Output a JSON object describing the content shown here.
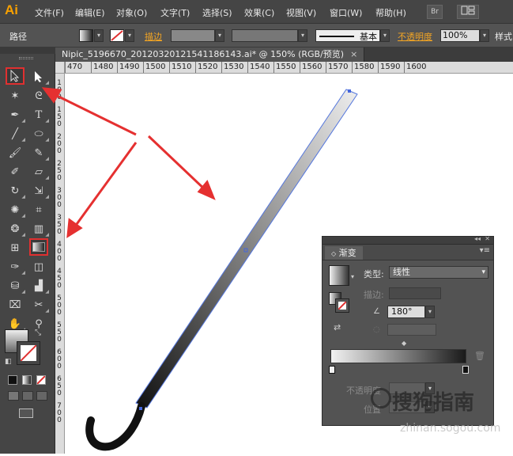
{
  "app": {
    "logo": "Ai"
  },
  "menu": [
    "文件(F)",
    "编辑(E)",
    "对象(O)",
    "文字(T)",
    "选择(S)",
    "效果(C)",
    "视图(V)",
    "窗口(W)",
    "帮助(H)"
  ],
  "menubar_buttons": {
    "bridge": "Br"
  },
  "control_bar": {
    "selection_label": "路径",
    "stroke_label": "描边",
    "stroke_style": "基本",
    "opacity_label": "不透明度",
    "opacity_value": "100%",
    "style_label": "样式"
  },
  "document_tab": {
    "title": "Nipic_5196670_20120320121541186143.ai* @ 150% (RGB/预览)",
    "close": "×"
  },
  "ruler_h": [
    "470",
    "1480",
    "1490",
    "1500",
    "1510",
    "1520",
    "1530",
    "1540",
    "1550",
    "1560",
    "1570",
    "1580",
    "1590",
    "1600"
  ],
  "ruler_v": [
    "1\n0\n0",
    "1\n5\n0",
    "2\n0\n0",
    "2\n5\n0",
    "3\n0\n0",
    "3\n5\n0",
    "4\n0\n0",
    "4\n5\n0",
    "5\n0\n0",
    "5\n5\n0",
    "6\n0\n0",
    "6\n5\n0",
    "7\n0\n0"
  ],
  "gradient_panel": {
    "tab_label": "渐变",
    "type_label": "类型:",
    "type_value": "线性",
    "stroke_label": "描边:",
    "angle_value": "180°",
    "opacity_label": "不透明度",
    "location_label": "位置"
  },
  "watermark": {
    "text": "搜狗指南",
    "sub": "zhinan.sogou.com"
  },
  "colors": {
    "annotation_arrow": "#e53030",
    "accent_orange": "#f5a623",
    "ui_dark": "#454545"
  }
}
